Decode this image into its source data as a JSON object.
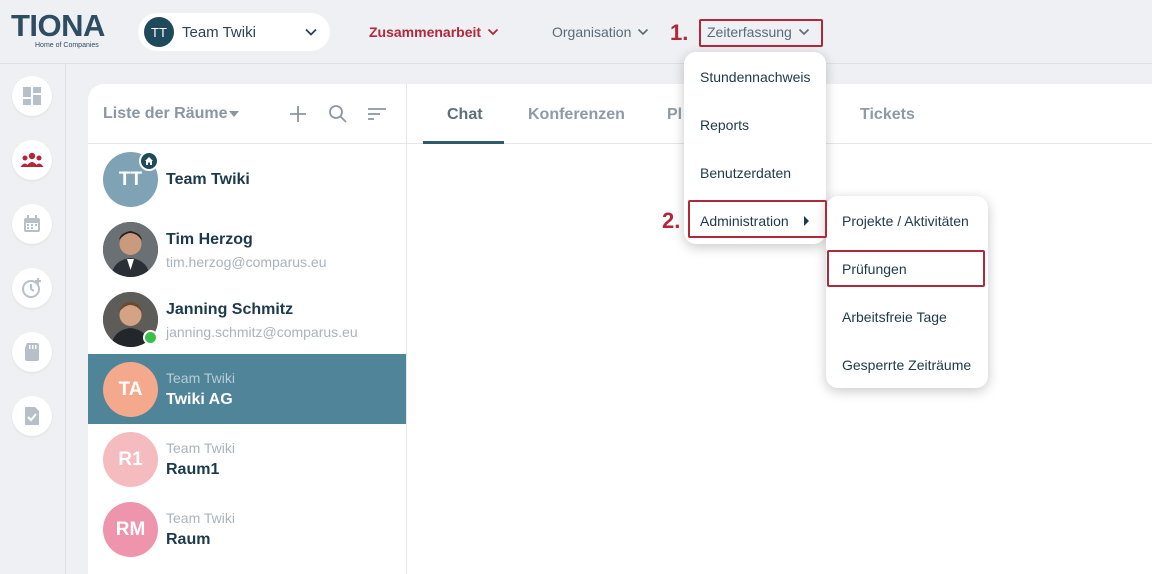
{
  "brand": {
    "name": "TIONA",
    "tagline": "Home of Companies"
  },
  "team_selector": {
    "initials": "TT",
    "name": "Team Twiki"
  },
  "nav": {
    "collaboration": "Zusammenarbeit",
    "organisation": "Organisation",
    "time_tracking": "Zeiterfassung"
  },
  "step_markers": {
    "step1": "1.",
    "step2": "2."
  },
  "rooms_panel": {
    "title": "Liste der Räume",
    "rooms": [
      {
        "initials": "TT",
        "title": "Team Twiki",
        "subtitle": ""
      },
      {
        "initials": "",
        "title": "Tim Herzog",
        "subtitle": "tim.herzog@comparus.eu"
      },
      {
        "initials": "",
        "title": "Janning Schmitz",
        "subtitle": "janning.schmitz@comparus.eu"
      },
      {
        "initials": "TA",
        "title": "Twiki AG",
        "subtitle": "Team Twiki"
      },
      {
        "initials": "R1",
        "title": "Raum1",
        "subtitle": "Team Twiki"
      },
      {
        "initials": "RM",
        "title": "Raum",
        "subtitle": "Team Twiki"
      }
    ]
  },
  "tabs": [
    "Chat",
    "Konferenzen",
    "Pl",
    "Tickets"
  ],
  "zeiterfassung_menu": [
    "Stundennachweis",
    "Reports",
    "Benutzerdaten",
    "Administration"
  ],
  "administration_submenu": [
    "Projekte / Aktivitäten",
    "Prüfungen",
    "Arbeitsfreie Tage",
    "Gesperrte Zeiträume"
  ],
  "colors": {
    "accent_red": "#b0283a",
    "primary_teal": "#4f8499",
    "dark_teal": "#1f4a5c",
    "avatar_team": "#7fa3b4",
    "avatar_ta": "#f5a98c",
    "avatar_r1": "#f4bcbe",
    "avatar_rm": "#ee94ad",
    "online": "#3cbf4a"
  }
}
